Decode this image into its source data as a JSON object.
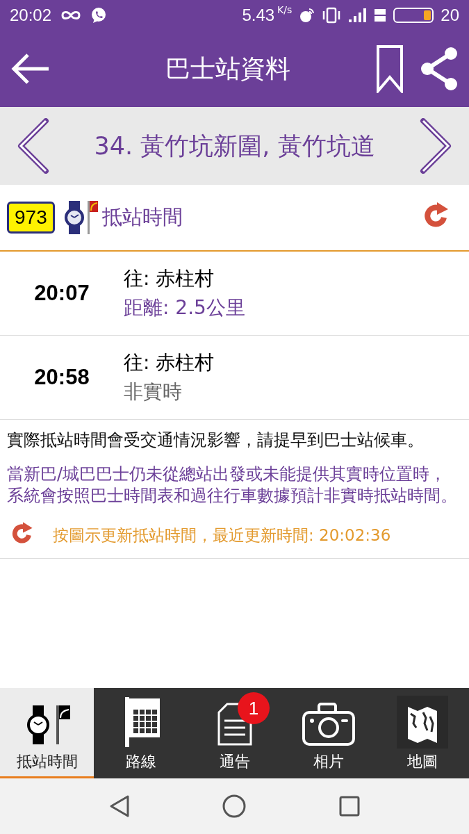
{
  "status_bar": {
    "time": "20:02",
    "speed": "5.43",
    "speed_unit": "K/s",
    "battery_text": "20"
  },
  "app_bar": {
    "title": "巴士站資料"
  },
  "stop": {
    "name": "34.  黃竹坑新圍, 黃竹坑道"
  },
  "route_header": {
    "route": "973",
    "label": "抵站時間"
  },
  "arrivals": [
    {
      "time": "20:07",
      "destination": "往: 赤柱村",
      "detail": "距離: 2.5公里",
      "realtime": true
    },
    {
      "time": "20:58",
      "destination": "往: 赤柱村",
      "detail": "非實時",
      "realtime": false
    }
  ],
  "notes": [
    {
      "text": "實際抵站時間會受交通情況影響，請提早到巴士站候車。",
      "kind": "plain"
    },
    {
      "text": "當新巴/城巴巴士仍未從總站出發或未能提供其實時位置時，系統會按照巴士時間表和過往行車數據預計非實時抵站時間。",
      "kind": "info"
    }
  ],
  "refresh_note": "按圖示更新抵站時間，最近更新時間: 20:02:36",
  "tabs": [
    {
      "label": "抵站時間",
      "kind": "watch",
      "selected": true
    },
    {
      "label": "路線",
      "kind": "table",
      "selected": false
    },
    {
      "label": "通告",
      "kind": "document",
      "selected": false,
      "badge": "1"
    },
    {
      "label": "相片",
      "kind": "camera",
      "selected": false
    },
    {
      "label": "地圖",
      "kind": "map",
      "selected": false
    }
  ]
}
